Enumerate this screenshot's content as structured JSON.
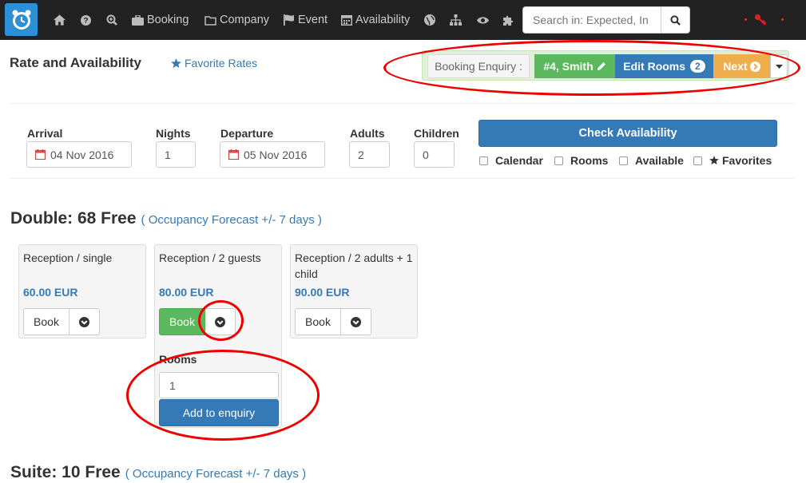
{
  "navbar": {
    "items": [
      {
        "icon": "home-icon",
        "label": ""
      },
      {
        "icon": "help-icon",
        "label": ""
      },
      {
        "icon": "zoom-icon",
        "label": ""
      },
      {
        "icon": "briefcase-icon",
        "label": "Booking"
      },
      {
        "icon": "folder-icon",
        "label": "Company"
      },
      {
        "icon": "flag-icon",
        "label": "Event"
      },
      {
        "icon": "calendar-icon",
        "label": "Availability"
      },
      {
        "icon": "globe-icon",
        "label": ""
      },
      {
        "icon": "sitemap-icon",
        "label": ""
      },
      {
        "icon": "eye-icon",
        "label": ""
      },
      {
        "icon": "puzzle-icon",
        "label": ""
      }
    ],
    "search": {
      "placeholder": "Search in: Expected, In",
      "value": ""
    }
  },
  "header": {
    "title": "Rate and Availability",
    "favorite_rates": "Favorite Rates"
  },
  "enquiry": {
    "label": "Booking Enquiry :",
    "guest": "#4, Smith",
    "edit_rooms": "Edit Rooms",
    "room_count": "2",
    "next": "Next"
  },
  "form": {
    "arrival_label": "Arrival",
    "arrival_value": "04 Nov 2016",
    "nights_label": "Nights",
    "nights_value": "1",
    "departure_label": "Departure",
    "departure_value": "05 Nov 2016",
    "adults_label": "Adults",
    "adults_value": "2",
    "children_label": "Children",
    "children_value": "0",
    "check_button": "Check Availability",
    "options": [
      "Calendar",
      "Rooms",
      "Available",
      "Favorites"
    ]
  },
  "rooms": [
    {
      "heading": "Double: 68 Free",
      "forecast": "( Occupancy Forecast +/- 7 days )",
      "rates": [
        {
          "name": "Reception / single",
          "price": "60.00 EUR",
          "book": "Book"
        },
        {
          "name": "Reception / 2 guests",
          "price": "80.00 EUR",
          "book": "Book",
          "rooms_label": "Rooms",
          "rooms_value": "1",
          "add_button": "Add to enquiry"
        },
        {
          "name": "Reception / 2 adults + 1 child",
          "price": "90.00 EUR",
          "book": "Book"
        }
      ]
    },
    {
      "heading": "Suite: 10 Free",
      "forecast": "( Occupancy Forecast +/- 7 days )"
    }
  ]
}
